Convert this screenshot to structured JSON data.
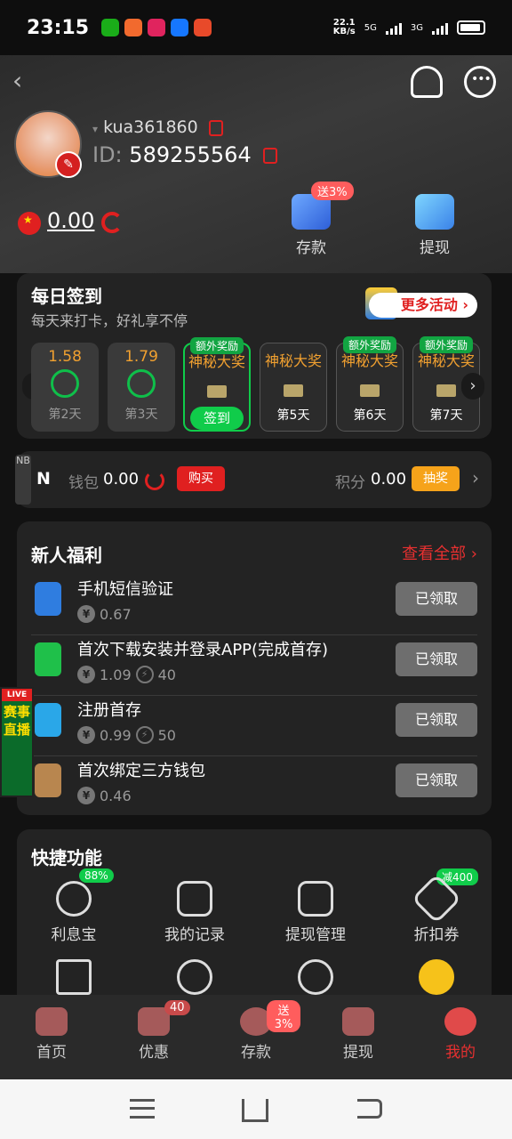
{
  "status_bar": {
    "time": "23:15",
    "net_speed": "22.1",
    "net_unit": "KB/s",
    "signal1": "5G",
    "signal2": "3G"
  },
  "profile": {
    "username": "kua361860",
    "id_label": "ID:",
    "id_value": "589255564",
    "balance": "0.00"
  },
  "actions": {
    "deposit_label": "存款",
    "deposit_badge": "送3%",
    "withdraw_label": "提现"
  },
  "checkin": {
    "title": "每日签到",
    "subtitle": "每天来打卡，好礼享不停",
    "more_label": "更多活动",
    "days": [
      {
        "amount": "1.58",
        "label": "第2天"
      },
      {
        "amount": "1.79",
        "label": "第3天"
      },
      {
        "tag": "额外奖励",
        "amount": "神秘大奖",
        "label": "签到"
      },
      {
        "amount": "神秘大奖",
        "label": "第5天"
      },
      {
        "tag": "额外奖励",
        "amount": "神秘大奖",
        "label": "第6天"
      },
      {
        "tag": "额外奖励",
        "amount": "神秘大奖",
        "label": "第7天"
      }
    ]
  },
  "wallet": {
    "tab_text": "NB",
    "logo": "N",
    "wallet_label": "钱包",
    "wallet_value": "0.00",
    "buy_label": "购买",
    "points_label": "积分",
    "points_value": "0.00",
    "draw_label": "抽奖"
  },
  "welfare": {
    "title": "新人福利",
    "view_all": "查看全部",
    "tasks": [
      {
        "title": "手机短信验证",
        "reward": "0.67",
        "bolt": "",
        "button": "已领取"
      },
      {
        "title": "首次下载安装并登录APP(完成首存)",
        "reward": "1.09",
        "bolt": "40",
        "button": "已领取"
      },
      {
        "title": "注册首存",
        "reward": "0.99",
        "bolt": "50",
        "button": "已领取"
      },
      {
        "title": "首次绑定三方钱包",
        "reward": "0.46",
        "bolt": "",
        "button": "已领取"
      }
    ]
  },
  "live_banner": {
    "tag": "LIVE",
    "text": "赛事直播"
  },
  "quick": {
    "title": "快捷功能",
    "items": [
      {
        "label": "利息宝",
        "badge": "88%"
      },
      {
        "label": "我的记录",
        "badge": ""
      },
      {
        "label": "提现管理",
        "badge": ""
      },
      {
        "label": "折扣券",
        "badge": "减400"
      }
    ]
  },
  "bottom_nav": {
    "items": [
      {
        "label": "首页",
        "badge": ""
      },
      {
        "label": "优惠",
        "badge": "40"
      },
      {
        "label": "存款",
        "badge": "送3%"
      },
      {
        "label": "提现",
        "badge": ""
      },
      {
        "label": "我的",
        "badge": ""
      }
    ]
  },
  "colors": {
    "accent_red": "#e02020",
    "accent_green": "#10cc4a",
    "accent_orange": "#f6a31a"
  }
}
